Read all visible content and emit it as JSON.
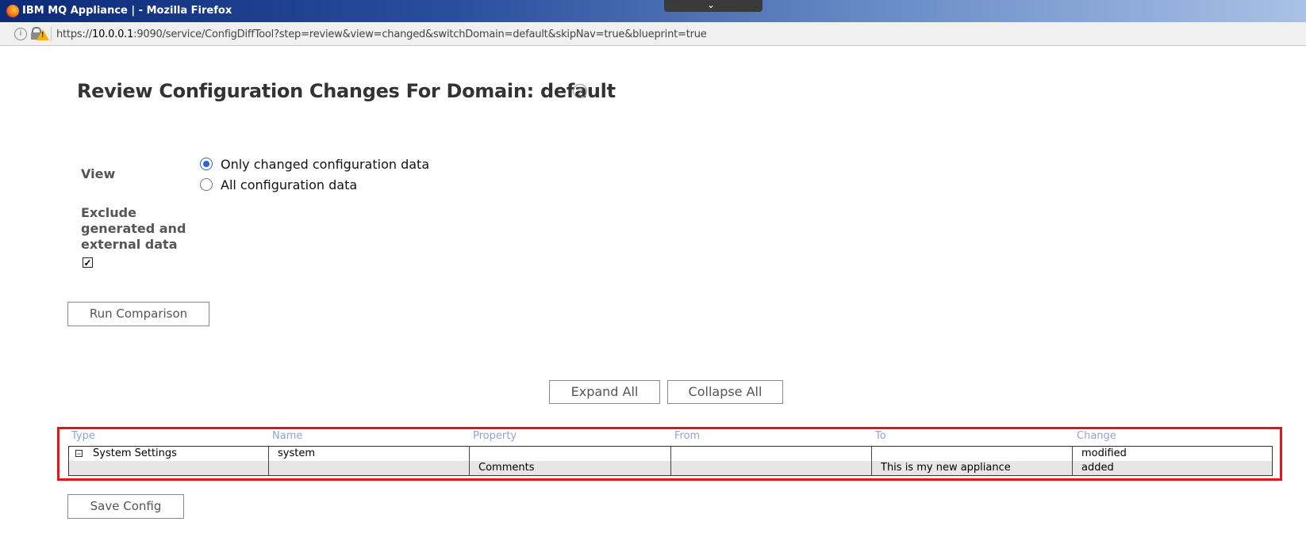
{
  "window": {
    "title": "IBM MQ Appliance | - Mozilla Firefox",
    "collapse_glyph": "⌄"
  },
  "urlbar": {
    "url_prefix": "https://",
    "url_host": "10.0.0.1",
    "url_rest": ":9090/service/ConfigDiffTool?step=review&view=changed&switchDomain=default&skipNav=true&blueprint=true",
    "info_glyph": "i"
  },
  "page": {
    "heading": "Review Configuration Changes For Domain: default",
    "help_glyph": "?"
  },
  "form": {
    "view_label": "View",
    "view_options": [
      {
        "label": "Only changed configuration data",
        "selected": true
      },
      {
        "label": "All configuration data",
        "selected": false
      }
    ],
    "exclude_label_lines": [
      "Exclude",
      "generated and",
      "external data"
    ],
    "exclude_checked": true,
    "checkbox_glyph": "✓",
    "run_button": "Run Comparison"
  },
  "tree_controls": {
    "expand_all": "Expand All",
    "collapse_all": "Collapse All"
  },
  "table": {
    "columns": [
      "Type",
      "Name",
      "Property",
      "From",
      "To",
      "Change"
    ],
    "rows": [
      {
        "expander": "−",
        "type": "System Settings",
        "name": "system",
        "property": "",
        "from": "",
        "to": "",
        "change": "modified"
      },
      {
        "type": "",
        "name": "",
        "property": "Comments",
        "from": "",
        "to": "This is my new appliance",
        "change": "added"
      }
    ]
  },
  "footer": {
    "save_button": "Save Config"
  },
  "colors": {
    "highlight_frame": "#e8131a",
    "header_text": "#8fa4d6",
    "radio_accent": "#2a62d9"
  }
}
